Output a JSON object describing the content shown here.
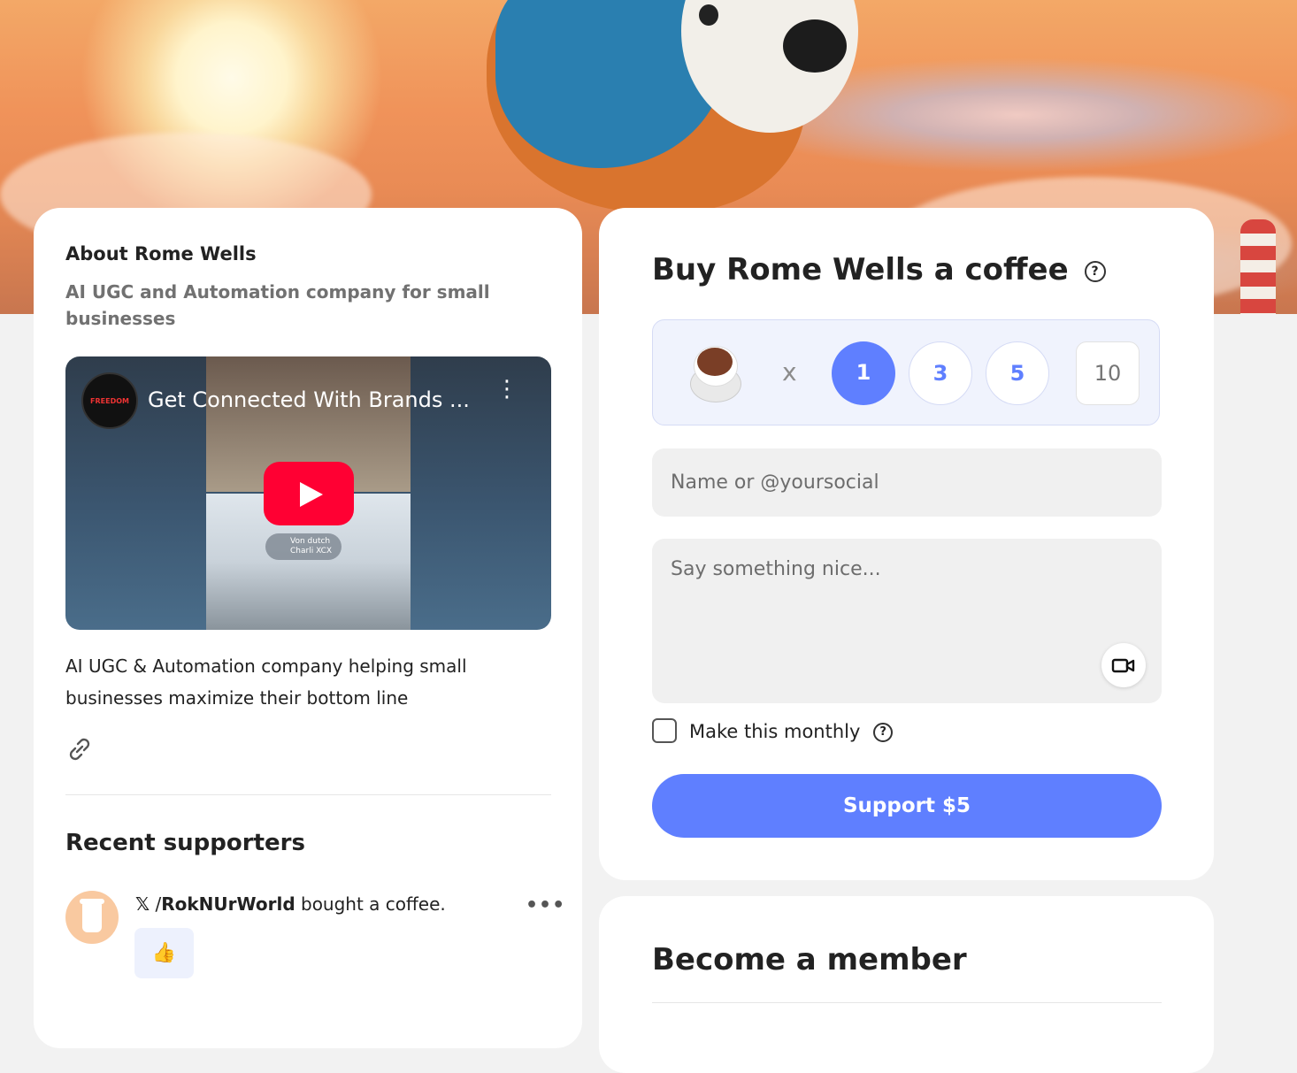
{
  "about": {
    "title": "About Rome Wells",
    "subtitle": "AI UGC and Automation company for small businesses",
    "video": {
      "title": "Get Connected With Brands ...",
      "channel_badge": "FREEDOM",
      "song_title": "Von dutch",
      "song_artist": "Charli XCX"
    },
    "description": "AI UGC & Automation company helping small businesses maximize their bottom line",
    "link_icon": "link-icon"
  },
  "recent": {
    "title": "Recent supporters",
    "supporters": [
      {
        "platform_icon": "𝕏",
        "separator": "/",
        "handle": "RokNUrWorld",
        "action": "bought a coffee.",
        "reaction": "👍"
      }
    ]
  },
  "buy": {
    "title": "Buy Rome Wells a coffee",
    "times": "x",
    "quantities": [
      "1",
      "3",
      "5"
    ],
    "selected_quantity": "1",
    "custom_quantity_placeholder": "10",
    "name_placeholder": "Name or @yoursocial",
    "message_placeholder": "Say something nice...",
    "monthly_label": "Make this monthly",
    "support_button": "Support $5"
  },
  "member": {
    "title": "Become a member"
  },
  "colors": {
    "accent": "#5f7fff",
    "accent_light": "#f0f3fd",
    "field_bg": "#f0f0f0",
    "page_bg": "#f2f2f2"
  }
}
